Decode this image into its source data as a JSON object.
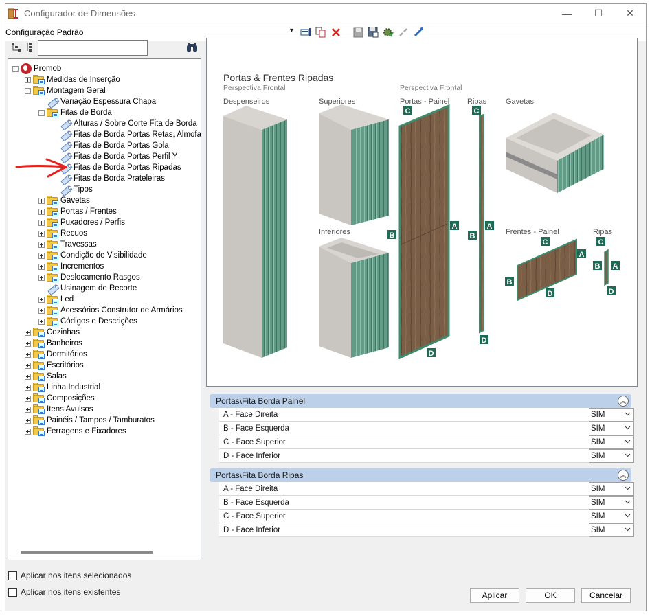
{
  "window": {
    "title": "Configurador de Dimensões",
    "minimize": "—",
    "maximize": "☐",
    "close": "✕"
  },
  "toolbar": {
    "config_label": "Configuração Padrão",
    "dropdown_glyph": "▾",
    "icons": [
      "edit-form-icon",
      "copy-icon",
      "delete-icon",
      "save-icon",
      "save-as-icon",
      "settings-icon",
      "unlink-icon",
      "link-icon"
    ]
  },
  "tree": {
    "search_value": "",
    "items": [
      {
        "label": "Promob",
        "type": "root",
        "expander": "minus"
      },
      {
        "label": "Medidas de Inserção",
        "type": "folder",
        "expander": "plus"
      },
      {
        "label": "Montagem Geral",
        "type": "folder",
        "expander": "minus"
      },
      {
        "label": "Variação Espessura Chapa",
        "type": "tag",
        "expander": "none"
      },
      {
        "label": "Fitas de Borda",
        "type": "folder",
        "expander": "minus"
      },
      {
        "label": "Alturas / Sobre Corte Fita de Borda",
        "type": "tag",
        "expander": "none"
      },
      {
        "label": "Fitas de Borda Portas Retas, Almofada",
        "type": "tag",
        "expander": "none"
      },
      {
        "label": "Fitas de Borda Portas Gola",
        "type": "tag",
        "expander": "none"
      },
      {
        "label": "Fitas de Borda Portas Perfil Y",
        "type": "tag",
        "expander": "none"
      },
      {
        "label": "Fitas de Borda Portas Ripadas",
        "type": "tag",
        "expander": "none"
      },
      {
        "label": "Fitas de Borda Prateleiras",
        "type": "tag",
        "expander": "none"
      },
      {
        "label": "Tipos",
        "type": "tag",
        "expander": "none"
      },
      {
        "label": "Gavetas",
        "type": "folder",
        "expander": "plus"
      },
      {
        "label": "Portas / Frentes",
        "type": "folder",
        "expander": "plus"
      },
      {
        "label": "Puxadores / Perfis",
        "type": "folder",
        "expander": "plus"
      },
      {
        "label": "Recuos",
        "type": "folder",
        "expander": "plus"
      },
      {
        "label": "Travessas",
        "type": "folder",
        "expander": "plus"
      },
      {
        "label": "Condição de Visibilidade",
        "type": "folder",
        "expander": "plus"
      },
      {
        "label": "Incrementos",
        "type": "folder",
        "expander": "plus"
      },
      {
        "label": "Deslocamento Rasgos",
        "type": "folder",
        "expander": "plus"
      },
      {
        "label": "Usinagem de Recorte",
        "type": "tag",
        "expander": "none"
      },
      {
        "label": "Led",
        "type": "folder",
        "expander": "plus"
      },
      {
        "label": "Acessórios Construtor de Armários",
        "type": "folder",
        "expander": "plus"
      },
      {
        "label": "Códigos e Descrições",
        "type": "folder",
        "expander": "plus"
      },
      {
        "label": "Cozinhas",
        "type": "folder",
        "expander": "plus"
      },
      {
        "label": "Banheiros",
        "type": "folder",
        "expander": "plus"
      },
      {
        "label": "Dormitórios",
        "type": "folder",
        "expander": "plus"
      },
      {
        "label": "Escritórios",
        "type": "folder",
        "expander": "plus"
      },
      {
        "label": "Salas",
        "type": "folder",
        "expander": "plus"
      },
      {
        "label": "Linha Industrial",
        "type": "folder",
        "expander": "plus"
      },
      {
        "label": "Composições",
        "type": "folder",
        "expander": "plus"
      },
      {
        "label": "Itens Avulsos",
        "type": "folder",
        "expander": "plus"
      },
      {
        "label": "Painéis / Tampos / Tamburatos",
        "type": "folder",
        "expander": "plus"
      },
      {
        "label": "Ferragens e Fixadores",
        "type": "folder",
        "expander": "plus"
      }
    ]
  },
  "options": {
    "apply_selected": "Aplicar nos itens selecionados",
    "apply_existing": "Aplicar nos itens existentes"
  },
  "preview": {
    "title": "Portas & Frentes Ripadas",
    "subtitle_left": "Perspectiva Frontal",
    "subtitle_right": "Perspectiva Frontal",
    "despenseiros": "Despenseiros",
    "superiores": "Superiores",
    "inferiores": "Inferiores",
    "portas_painel": "Portas - Painel",
    "ripas": "Ripas",
    "gavetas": "Gavetas",
    "frentes_painel": "Frentes - Painel",
    "ripas2": "Ripas",
    "label_a": "A",
    "label_b": "B",
    "label_c": "C",
    "label_d": "D"
  },
  "groups": [
    {
      "title": "Portas\\Fita Borda Painel",
      "rows": [
        {
          "label": "A - Face Direita",
          "value": "SIM"
        },
        {
          "label": "B - Face Esquerda",
          "value": "SIM"
        },
        {
          "label": "C - Face Superior",
          "value": "SIM"
        },
        {
          "label": "D - Face Inferior",
          "value": "SIM"
        }
      ]
    },
    {
      "title": "Portas\\Fita Borda Ripas",
      "rows": [
        {
          "label": "A - Face Direita",
          "value": "SIM"
        },
        {
          "label": "B - Face Esquerda",
          "value": "SIM"
        },
        {
          "label": "C - Face Superior",
          "value": "SIM"
        },
        {
          "label": "D - Face Inferior",
          "value": "SIM"
        }
      ]
    }
  ],
  "buttons": {
    "apply": "Aplicar",
    "ok": "OK",
    "cancel": "Cancelar"
  },
  "colors": {
    "green_slat": "#5a9a82",
    "wood": "#7a5e45",
    "label_bg": "#1f6b55",
    "header_bg": "#bcd0ea",
    "annotation_arrow": "#e8211c"
  }
}
